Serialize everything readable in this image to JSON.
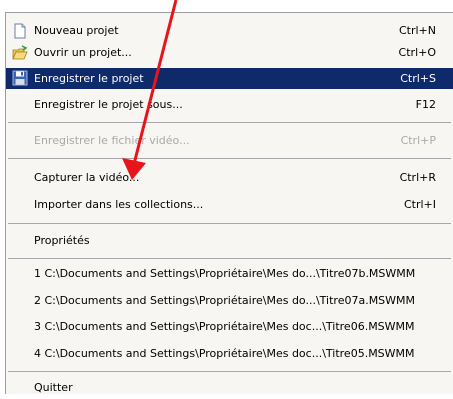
{
  "menu": {
    "items": [
      {
        "label": "Nouveau projet",
        "shortcut": "Ctrl+N",
        "icon": "new-document-icon"
      },
      {
        "label": "Ouvrir un projet...",
        "shortcut": "Ctrl+O",
        "icon": "open-folder-icon"
      },
      {
        "label": "Enregistrer le projet",
        "shortcut": "Ctrl+S",
        "icon": "floppy-disk-icon",
        "state": "highlighted"
      },
      {
        "label": "Enregistrer le projet sous...",
        "shortcut": "F12"
      },
      {
        "label": "Enregistrer le fichier vidéo...",
        "shortcut": "Ctrl+P",
        "state": "disabled"
      },
      {
        "label": "Capturer la vidéo...",
        "shortcut": "Ctrl+R"
      },
      {
        "label": "Importer dans les collections...",
        "shortcut": "Ctrl+I"
      },
      {
        "label": "Propriétés"
      },
      {
        "label": "1 C:\\Documents and Settings\\Propriétaire\\Mes do...\\Titre07b.MSWMM"
      },
      {
        "label": "2 C:\\Documents and Settings\\Propriétaire\\Mes do...\\Titre07a.MSWMM"
      },
      {
        "label": "3 C:\\Documents and Settings\\Propriétaire\\Mes doc...\\Titre06.MSWMM"
      },
      {
        "label": "4 C:\\Documents and Settings\\Propriétaire\\Mes doc...\\Titre05.MSWMM"
      },
      {
        "label": "Quitter"
      }
    ]
  },
  "colors": {
    "highlight": "#0f2a6b",
    "menu_background": "#f7f6f2",
    "disabled_text": "#a9a9a9",
    "annotation_arrow": "#e8141c"
  }
}
